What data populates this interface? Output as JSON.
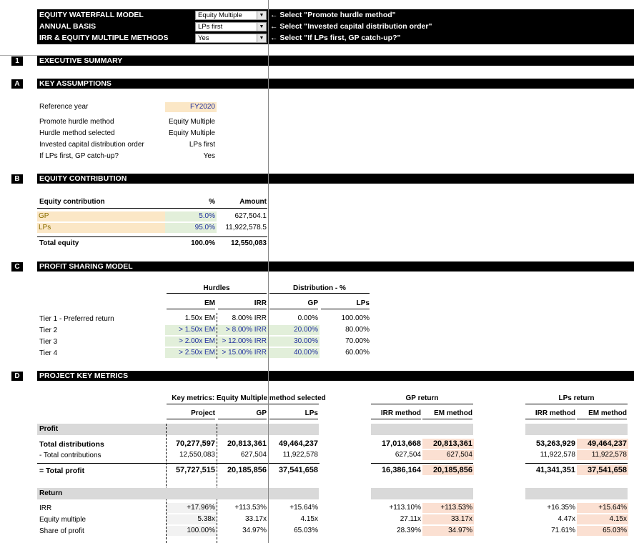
{
  "header": {
    "rows": [
      {
        "label": "EQUITY WATERFALL MODEL",
        "value": "Equity Multiple",
        "hint": "← Select \"Promote hurdle method\""
      },
      {
        "label": "ANNUAL BASIS",
        "value": "LPs first",
        "hint": "← Select \"Invested capital distribution order\""
      },
      {
        "label": "IRR & EQUITY MULTIPLE METHODS",
        "value": "Yes",
        "hint": "← Select \"If LPs first, GP catch-up?\""
      }
    ]
  },
  "sections": {
    "s1": {
      "num": "1",
      "title": "EXECUTIVE SUMMARY"
    },
    "sA": {
      "num": "A",
      "title": "KEY ASSUMPTIONS"
    },
    "sB": {
      "num": "B",
      "title": "EQUITY CONTRIBUTION"
    },
    "sC": {
      "num": "C",
      "title": "PROFIT SHARING MODEL"
    },
    "sD": {
      "num": "D",
      "title": "PROJECT KEY METRICS"
    }
  },
  "assumptions": {
    "reference_year_label": "Reference year",
    "reference_year": "FY2020",
    "rows": [
      {
        "label": "Promote hurdle method",
        "value": "Equity Multiple"
      },
      {
        "label": "Hurdle method selected",
        "value": "Equity Multiple"
      },
      {
        "label": "Invested capital distribution order",
        "value": "LPs first"
      },
      {
        "label": "If LPs first, GP catch-up?",
        "value": "Yes"
      }
    ]
  },
  "equity": {
    "headers": {
      "label": "Equity contribution",
      "pct": "%",
      "amount": "Amount"
    },
    "rows": [
      {
        "label": "GP",
        "pct": "5.0%",
        "amount": "627,504.1"
      },
      {
        "label": "LPs",
        "pct": "95.0%",
        "amount": "11,922,578.5"
      }
    ],
    "total": {
      "label": "Total equity",
      "pct": "100.0%",
      "amount": "12,550,083"
    }
  },
  "profit_sharing": {
    "group_hurdles": "Hurdles",
    "group_distribution": "Distribution - %",
    "col_em": "EM",
    "col_irr": "IRR",
    "col_gp": "GP",
    "col_lps": "LPs",
    "tiers": [
      {
        "label": "Tier 1 - Preferred return",
        "em": "1.50x EM",
        "irr": "8.00% IRR",
        "gp": "0.00%",
        "lps": "100.00%"
      },
      {
        "label": "Tier 2",
        "em": "> 1.50x EM",
        "irr": "> 8.00% IRR",
        "gp": "20.00%",
        "lps": "80.00%"
      },
      {
        "label": "Tier 3",
        "em": "> 2.00x EM",
        "irr": "> 12.00% IRR",
        "gp": "30.00%",
        "lps": "70.00%"
      },
      {
        "label": "Tier 4",
        "em": "> 2.50x EM",
        "irr": "> 15.00% IRR",
        "gp": "40.00%",
        "lps": "60.00%"
      }
    ]
  },
  "metrics": {
    "group_key": "Key metrics: Equity Multiple method selected",
    "group_gp": "GP return",
    "group_lps": "LPs return",
    "cols": {
      "project": "Project",
      "gp": "GP",
      "lps": "LPs",
      "irr_method": "IRR method",
      "em_method": "EM method"
    },
    "profit_header": "Profit",
    "return_header": "Return",
    "profit_rows": [
      {
        "label": "Total distributions",
        "project": "70,277,597",
        "gp": "20,813,361",
        "lps": "49,464,237",
        "gp_irr": "17,013,668",
        "gp_em": "20,813,361",
        "lp_irr": "53,263,929",
        "lp_em": "49,464,237"
      },
      {
        "label": "- Total contributions",
        "project": "12,550,083",
        "gp": "627,504",
        "lps": "11,922,578",
        "gp_irr": "627,504",
        "gp_em": "627,504",
        "lp_irr": "11,922,578",
        "lp_em": "11,922,578"
      },
      {
        "label": "= Total profit",
        "project": "57,727,515",
        "gp": "20,185,856",
        "lps": "37,541,658",
        "gp_irr": "16,386,164",
        "gp_em": "20,185,856",
        "lp_irr": "41,341,351",
        "lp_em": "37,541,658"
      }
    ],
    "return_rows": [
      {
        "label": "IRR",
        "project": "+17.96%",
        "gp": "+113.53%",
        "lps": "+15.64%",
        "gp_irr": "+113.10%",
        "gp_em": "+113.53%",
        "lp_irr": "+16.35%",
        "lp_em": "+15.64%"
      },
      {
        "label": "Equity multiple",
        "project": "5.38x",
        "gp": "33.17x",
        "lps": "4.15x",
        "gp_irr": "27.11x",
        "gp_em": "33.17x",
        "lp_irr": "4.47x",
        "lp_em": "4.15x"
      },
      {
        "label": "Share of profit",
        "project": "100.00%",
        "gp": "34.97%",
        "lps": "65.03%",
        "gp_irr": "28.39%",
        "gp_em": "34.97%",
        "lp_irr": "71.61%",
        "lp_em": "65.03%"
      }
    ]
  }
}
